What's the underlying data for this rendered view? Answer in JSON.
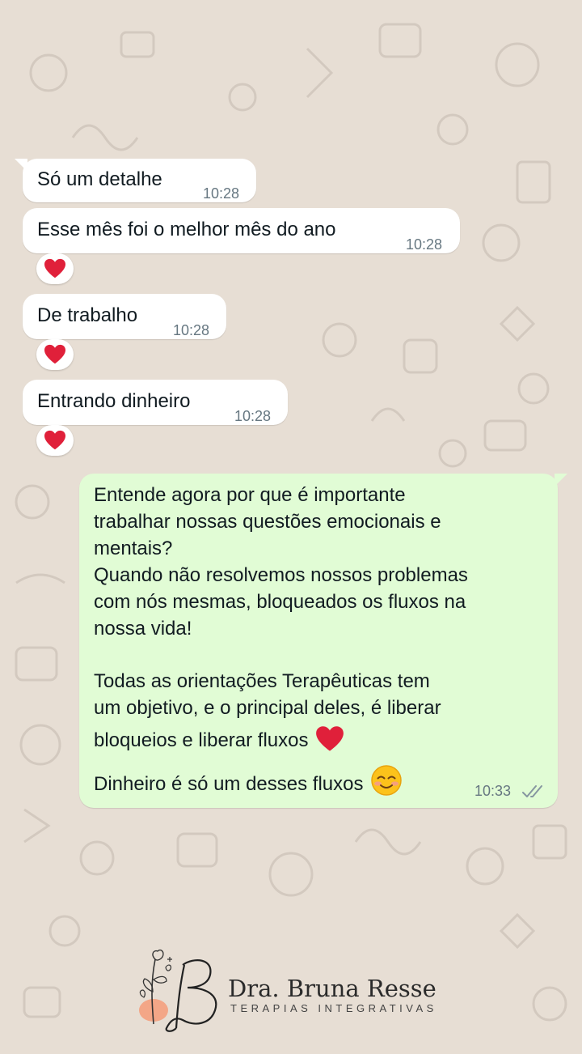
{
  "chat": {
    "received": [
      {
        "text": "Só um detalhe",
        "time": "10:28"
      },
      {
        "text": "Esse mês foi o melhor mês do ano",
        "time": "10:28",
        "reaction": "red-heart"
      },
      {
        "text": "De trabalho",
        "time": "10:28",
        "reaction": "red-heart"
      },
      {
        "text": "Entrando dinheiro",
        "time": "10:28",
        "reaction": "red-heart"
      }
    ],
    "sent": {
      "lines": [
        "Entende agora por que é importante",
        "trabalhar nossas questões emocionais e",
        "mentais?",
        "Quando não resolvemos nossos problemas",
        "com nós mesmas, bloqueados os fluxos na",
        "nossa vida!",
        "Todas as orientações Terapêuticas tem",
        "um objetivo, e o principal deles, é liberar",
        "bloqueios e liberar fluxos",
        "Dinheiro é só um desses fluxos"
      ],
      "emojis": [
        "red-heart",
        "smiling-face"
      ],
      "time": "10:33",
      "status_icon": "double-check-icon"
    }
  },
  "branding": {
    "name": "Dra. Bruna Resse",
    "subtitle": "TERAPIAS INTEGRATIVAS"
  },
  "colors": {
    "background": "#e7ded4",
    "incoming_bubble": "#ffffff",
    "outgoing_bubble": "#e1fcd5",
    "timestamp": "#667781",
    "heart": "#e0203a",
    "logo_accent": "#f4a07e"
  }
}
